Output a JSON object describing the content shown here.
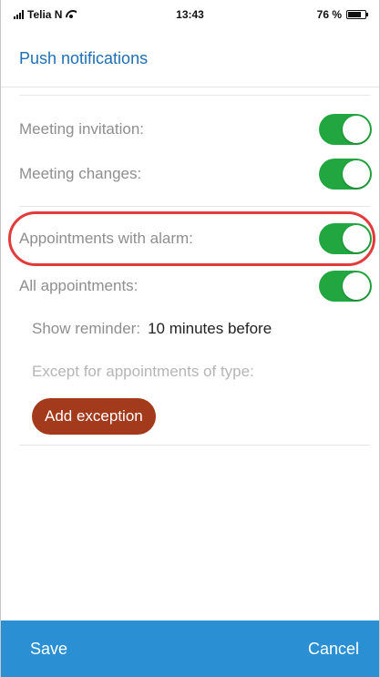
{
  "status": {
    "carrier": "Telia N",
    "time": "13:43",
    "battery": "76 %",
    "battery_level": 0.76
  },
  "header": {
    "title": "Push notifications"
  },
  "settings": {
    "meeting_invitation": {
      "label": "Meeting invitation:",
      "enabled": true
    },
    "meeting_changes": {
      "label": "Meeting changes:",
      "enabled": true
    },
    "appointments_alarm": {
      "label": "Appointments with alarm:",
      "enabled": true
    },
    "all_appointments": {
      "label": "All appointments:",
      "enabled": true
    }
  },
  "reminder": {
    "label": "Show reminder:",
    "value": "10 minutes before"
  },
  "exceptions": {
    "label": "Except for appointments of type:",
    "add_button": "Add exception"
  },
  "footer": {
    "save": "Save",
    "cancel": "Cancel"
  },
  "colors": {
    "accent": "#1f6fb5",
    "toggle_on": "#22a63f",
    "button": "#a33a1c",
    "bottom_bar": "#2a8fd3",
    "highlight": "#e23b3b"
  }
}
